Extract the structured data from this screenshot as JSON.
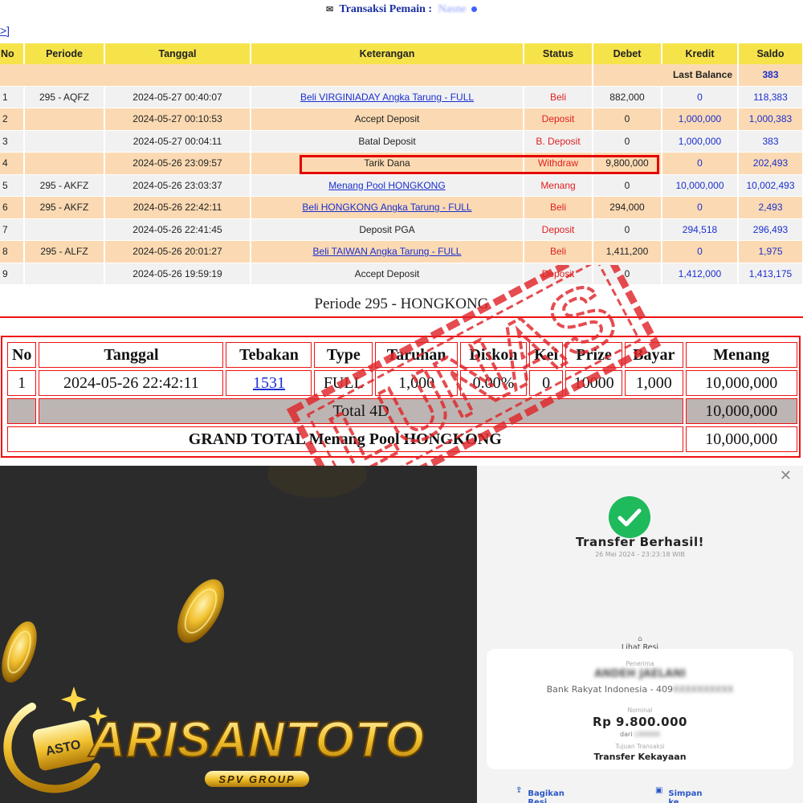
{
  "header": {
    "mail_icon": "envelope-icon",
    "label": "Transaksi  Pemain :",
    "player_name": "Nasne"
  },
  "back_link": ">]",
  "transactions": {
    "columns": [
      "No",
      "Periode",
      "Tanggal",
      "Keterangan",
      "Status",
      "Debet",
      "Kredit",
      "Saldo"
    ],
    "last_balance_label": "Last Balance",
    "last_balance_value": "383",
    "rows": [
      {
        "no": "1",
        "periode": "295 - AQFZ",
        "tanggal": "2024-05-27 00:40:07",
        "keterangan": "Beli VIRGINIADAY Angka Tarung - FULL",
        "link": true,
        "status": "Beli",
        "debet": "882,000",
        "kredit": "0",
        "saldo": "118,383"
      },
      {
        "no": "2",
        "periode": "",
        "tanggal": "2024-05-27 00:10:53",
        "keterangan": "Accept Deposit",
        "link": false,
        "status": "Deposit",
        "debet": "0",
        "kredit": "1,000,000",
        "saldo": "1,000,383"
      },
      {
        "no": "3",
        "periode": "",
        "tanggal": "2024-05-27 00:04:11",
        "keterangan": "Batal Deposit",
        "link": false,
        "status": "B. Deposit",
        "debet": "0",
        "kredit": "1,000,000",
        "saldo": "383"
      },
      {
        "no": "4",
        "periode": "",
        "tanggal": "2024-05-26 23:09:57",
        "keterangan": "Tarik Dana",
        "link": false,
        "status": "Withdraw",
        "debet": "9,800,000",
        "kredit": "0",
        "saldo": "202,493"
      },
      {
        "no": "5",
        "periode": "295 - AKFZ",
        "tanggal": "2024-05-26 23:03:37",
        "keterangan": "Menang Pool HONGKONG",
        "link": true,
        "status": "Menang",
        "debet": "0",
        "kredit": "10,000,000",
        "saldo": "10,002,493"
      },
      {
        "no": "6",
        "periode": "295 - AKFZ",
        "tanggal": "2024-05-26 22:42:11",
        "keterangan": "Beli HONGKONG Angka Tarung - FULL",
        "link": true,
        "status": "Beli",
        "debet": "294,000",
        "kredit": "0",
        "saldo": "2,493"
      },
      {
        "no": "7",
        "periode": "",
        "tanggal": "2024-05-26 22:41:45",
        "keterangan": "Deposit PGA",
        "link": false,
        "status": "Deposit",
        "debet": "0",
        "kredit": "294,518",
        "saldo": "296,493"
      },
      {
        "no": "8",
        "periode": "295 - ALFZ",
        "tanggal": "2024-05-26 20:01:27",
        "keterangan": "Beli TAIWAN Angka Tarung - FULL",
        "link": true,
        "status": "Beli",
        "debet": "1,411,200",
        "kredit": "0",
        "saldo": "1,975"
      },
      {
        "no": "9",
        "periode": "",
        "tanggal": "2024-05-26 19:59:19",
        "keterangan": "Accept Deposit",
        "link": false,
        "status": "Deposit",
        "debet": "0",
        "kredit": "1,412,000",
        "saldo": "1,413,175"
      }
    ]
  },
  "period": {
    "title": "Periode 295 - HONGKONG",
    "columns": [
      "No",
      "Tanggal",
      "Tebakan",
      "Type",
      "Taruhan",
      "Diskon",
      "Kei",
      "Prize",
      "Bayar",
      "Menang"
    ],
    "row": {
      "no": "1",
      "tanggal": "2024-05-26 22:42:11",
      "tebakan": "1531",
      "type": "FULL",
      "taruhan": "1,000",
      "diskon": "0.00%",
      "kei": "0",
      "prize": "10000",
      "bayar": "1,000",
      "menang": "10,000,000"
    },
    "total_label": "Total 4D",
    "total_value": "10,000,000",
    "grand_label": "GRAND TOTAL  Menang Pool HONGKONG",
    "grand_value": "10,000,000"
  },
  "stamp": {
    "text": "LUNAS",
    "color": "#e0262a"
  },
  "logo": {
    "brand": "ARISANTOTO",
    "tagline": "SPV GROUP",
    "emblem_text": "ASTO"
  },
  "receipt": {
    "close_icon": "close-icon",
    "success_icon": "check-circle-icon",
    "title": "Transfer Berhasil!",
    "datetime": "26 Mei 2024 - 23:23:18 WIB",
    "lihat_resi": "Lihat Resi",
    "penerima_label": "Penerima",
    "penerima_name": "ANDEH JAELANI",
    "bank": "Bank Rakyat Indonesia - 409",
    "bank_hidden": "XXXXXXXXXX",
    "nominal_label": "Nominal",
    "nominal": "Rp 9.800.000",
    "dari_prefix": "dari",
    "dari_hidden": "LXXXXX",
    "tujuan_label": "Tujuan Transaksi",
    "tujuan": "Transfer Kekayaan",
    "share_label": "Bagikan Resi",
    "save_label": "Simpan ke Daftar"
  },
  "colors": {
    "header_yellow": "#f6e34a",
    "row_peach": "#fbdab3",
    "row_gray": "#f1f1f1",
    "link_blue": "#1a2fd0",
    "status_red": "#e02020",
    "success_green": "#1fba5b",
    "gold": "#f2c12e"
  }
}
